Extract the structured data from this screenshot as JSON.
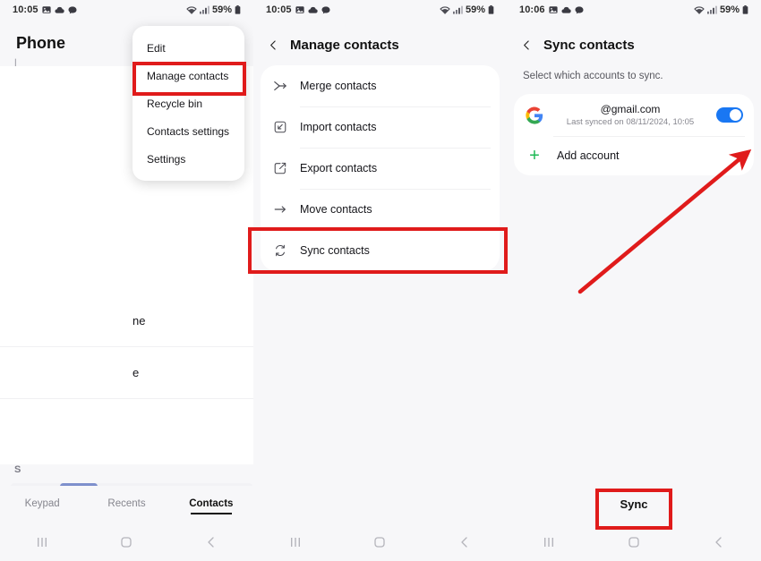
{
  "accent": {
    "red": "#e01b1b",
    "toggle_blue": "#1977f3",
    "plus_green": "#1db954"
  },
  "panel1": {
    "status": {
      "time": "10:05",
      "battery_pct": "59%"
    },
    "app_title": "Phone",
    "menu": [
      {
        "label": "Edit",
        "highlighted": false
      },
      {
        "label": "Manage contacts",
        "highlighted": true
      },
      {
        "label": "Recycle bin",
        "highlighted": false
      },
      {
        "label": "Contacts settings",
        "highlighted": false
      },
      {
        "label": "Settings",
        "highlighted": false
      }
    ],
    "ghost_rows": [
      {
        "label": "ne"
      },
      {
        "label": "e"
      }
    ],
    "section_letter": "S",
    "tabs": [
      {
        "label": "Keypad",
        "active": false
      },
      {
        "label": "Recents",
        "active": false
      },
      {
        "label": "Contacts",
        "active": true
      }
    ]
  },
  "panel2": {
    "status": {
      "time": "10:05",
      "battery_pct": "59%"
    },
    "title": "Manage contacts",
    "items": [
      {
        "label": "Merge contacts",
        "icon": "merge-icon",
        "highlighted": false
      },
      {
        "label": "Import contacts",
        "icon": "import-icon",
        "highlighted": false
      },
      {
        "label": "Export contacts",
        "icon": "export-icon",
        "highlighted": false
      },
      {
        "label": "Move contacts",
        "icon": "move-arrow-icon",
        "highlighted": false
      },
      {
        "label": "Sync contacts",
        "icon": "sync-icon",
        "highlighted": true
      }
    ]
  },
  "panel3": {
    "status": {
      "time": "10:06",
      "battery_pct": "59%"
    },
    "title": "Sync contacts",
    "hint": "Select which accounts to sync.",
    "account": {
      "email": "@gmail.com",
      "last_synced": "Last synced on 08/11/2024, 10:05",
      "toggle_on": true
    },
    "add_account_label": "Add account",
    "sync_button_label": "Sync"
  }
}
